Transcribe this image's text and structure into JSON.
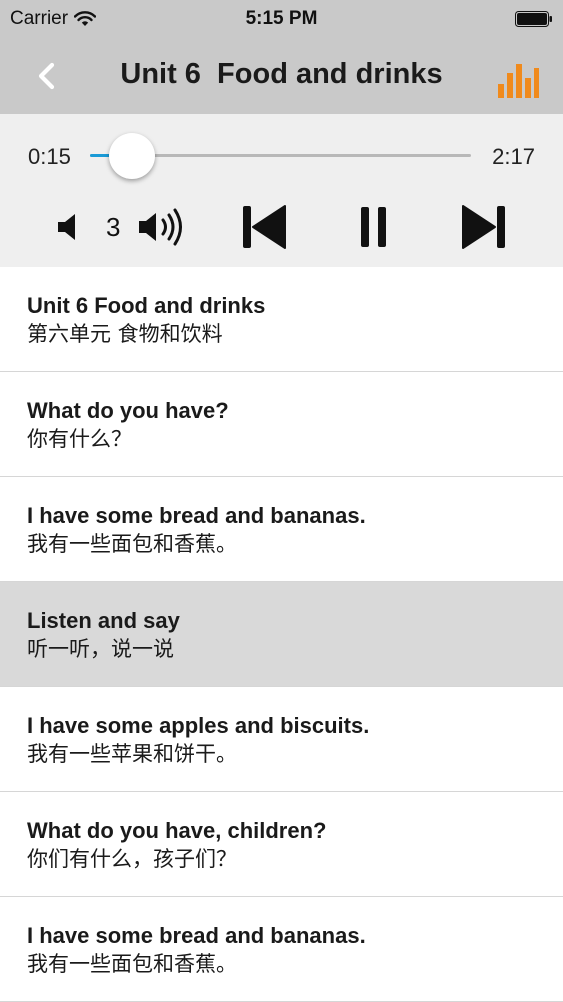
{
  "status_bar": {
    "carrier": "Carrier",
    "time": "5:15 PM"
  },
  "nav": {
    "title": "Unit 6  Food and drinks",
    "accent_color": "#f08a1c"
  },
  "player": {
    "elapsed": "0:15",
    "duration": "2:17",
    "progress": 0.11,
    "volume_level": "3",
    "track_color": "#1a9ad6"
  },
  "items": [
    {
      "en": "Unit 6 Food and drinks",
      "zh": "第六单元 食物和饮料",
      "selected": false
    },
    {
      "en": "What do you have?",
      "zh": "你有什么？",
      "selected": false
    },
    {
      "en": "I have some bread and bananas.",
      "zh": "我有一些面包和香蕉。",
      "selected": false
    },
    {
      "en": "Listen and say",
      "zh": "听一听，说一说",
      "selected": true
    },
    {
      "en": "I have some apples and biscuits.",
      "zh": "我有一些苹果和饼干。",
      "selected": false
    },
    {
      "en": "What do you have, children?",
      "zh": "你们有什么，孩子们？",
      "selected": false
    },
    {
      "en": "I have some bread and bananas.",
      "zh": "我有一些面包和香蕉。",
      "selected": false
    }
  ]
}
